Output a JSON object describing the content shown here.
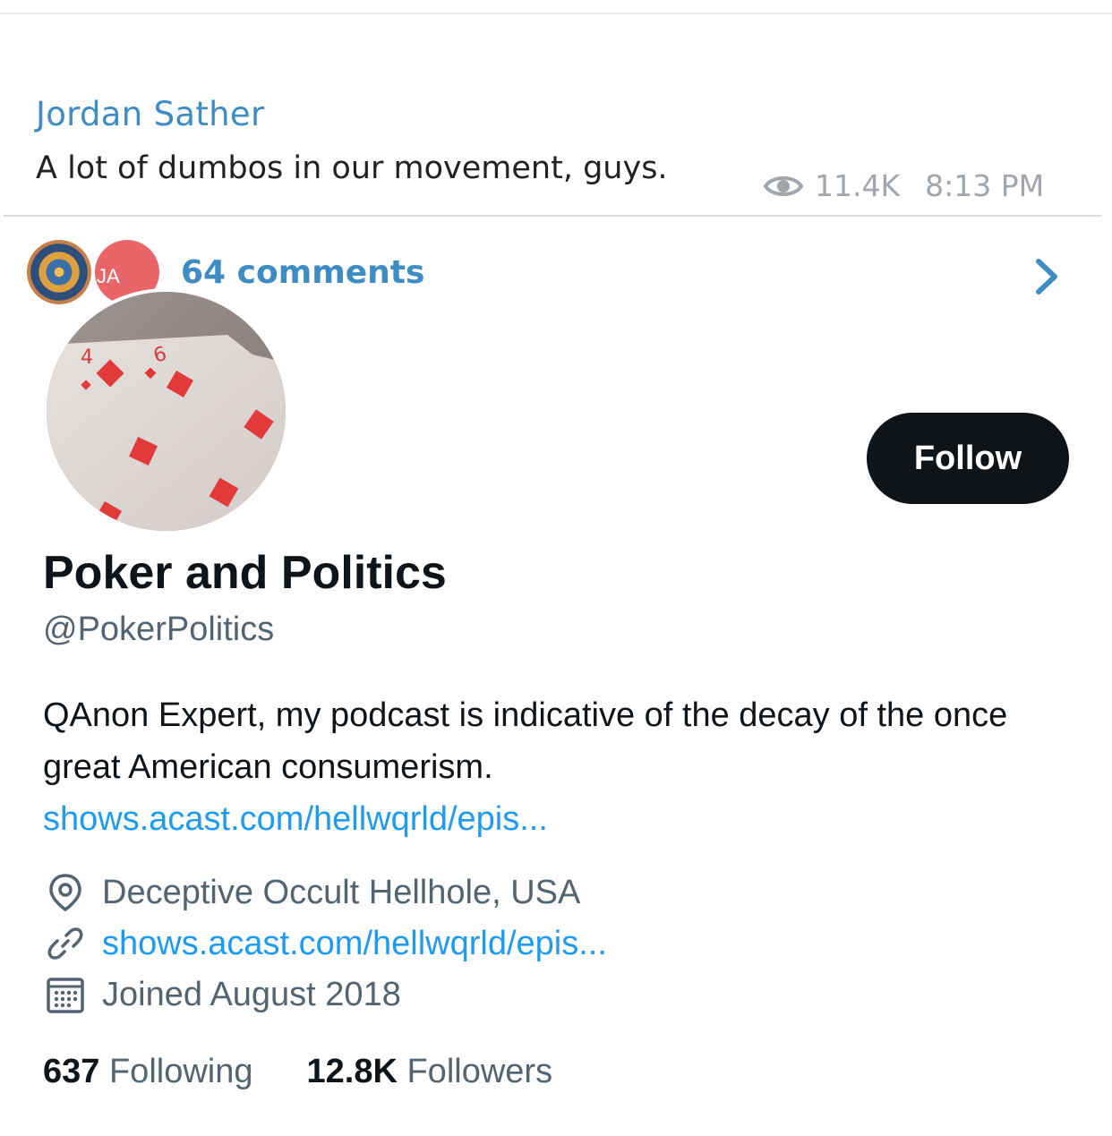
{
  "telegram_post": {
    "author": "Jordan Sather",
    "text": "A lot of dumbos in our movement, guys.",
    "views": "11.4K",
    "time": "8:13 PM",
    "comment_avatar_initials": "JA",
    "comments_label": "64 comments"
  },
  "profile": {
    "follow_label": "Follow",
    "display_name": "Poker and Politics",
    "handle": "@PokerPolitics",
    "bio": "QAnon Expert, my podcast is indicative of the decay of the once great American consumerism.",
    "bio_link": "shows.acast.com/hellwqrld/epis...",
    "location": "Deceptive Occult Hellhole, USA",
    "website": "shows.acast.com/hellwqrld/epis...",
    "joined": "Joined August 2018",
    "following_count": "637",
    "following_label": "Following",
    "followers_count": "12.8K",
    "followers_label": "Followers",
    "avatar_card_ranks": [
      "4",
      "6"
    ]
  },
  "colors": {
    "telegram_accent": "#3d8cc4",
    "twitter_link": "#1d9bf0",
    "twitter_text": "#0f1419",
    "twitter_secondary": "#536471",
    "follow_button": "#0f1419"
  },
  "icons": [
    "eye-icon",
    "chevron-right-icon",
    "location-pin-icon",
    "link-icon",
    "calendar-icon"
  ]
}
